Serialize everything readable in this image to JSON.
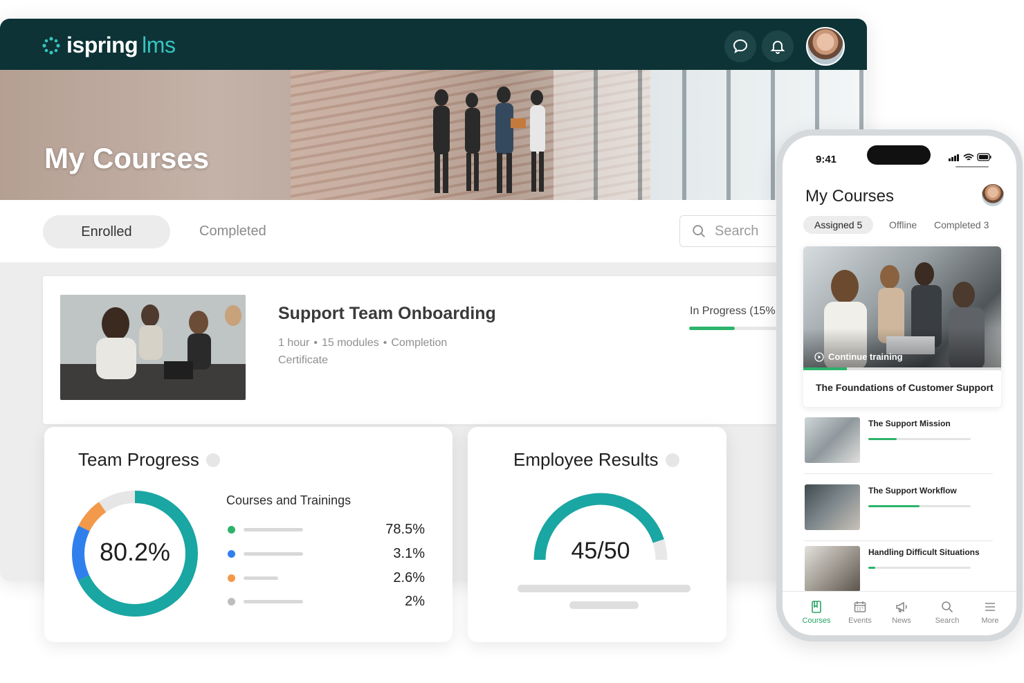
{
  "app": {
    "logo_main": "ispring",
    "logo_accent": "lms",
    "brand_color": "#0d3336",
    "accent_color": "#37c3c0",
    "progress_color": "#2db36a"
  },
  "header": {
    "chat_icon": "chat-bubble-icon",
    "bell_icon": "bell-icon",
    "avatar_icon": "user-avatar"
  },
  "hero": {
    "title": "My Courses"
  },
  "tabs": {
    "enrolled": "Enrolled",
    "completed": "Completed"
  },
  "search": {
    "placeholder": "Search"
  },
  "course": {
    "title": "Support Team Onboarding",
    "duration": "1 hour",
    "modules": "15 modules",
    "completion_a": "Completion",
    "completion_b": "Certificate",
    "status": "In Progress (15%",
    "progress": 0.15
  },
  "team_progress": {
    "title": "Team Progress",
    "center_value": "80.2%",
    "legend_title": "Courses and Trainings",
    "rows": [
      {
        "value": "78.5%",
        "color": "#2db36a"
      },
      {
        "value": "3.1%",
        "color": "#2f80ed"
      },
      {
        "value": "2.6%",
        "color": "#f2994a"
      },
      {
        "value": "2%",
        "color": "#bdbdbd"
      }
    ],
    "ring_colors": {
      "teal": "#1aa6a2",
      "blue": "#2f80ed",
      "orange": "#f2994a",
      "grey": "#e6e6e6"
    }
  },
  "employee_results": {
    "title": "Employee Results",
    "score": "45/50",
    "fraction": 0.9
  },
  "phone": {
    "time": "9:41",
    "title": "My Courses",
    "tabs": {
      "assigned": "Assigned 5",
      "offline": "Offline",
      "completed": "Completed 3"
    },
    "featured": {
      "continue": "Continue training",
      "title": "The Foundations of Customer Support",
      "progress": 0.22
    },
    "items": [
      {
        "name": "The Support Mission",
        "progress": 0.28
      },
      {
        "name": "The Support Workflow",
        "progress": 0.5
      },
      {
        "name": "Handling Difficult Situations",
        "progress": 0.07
      }
    ],
    "nav": {
      "courses": "Courses",
      "events": "Events",
      "news": "News",
      "search": "Search",
      "more": "More"
    }
  }
}
